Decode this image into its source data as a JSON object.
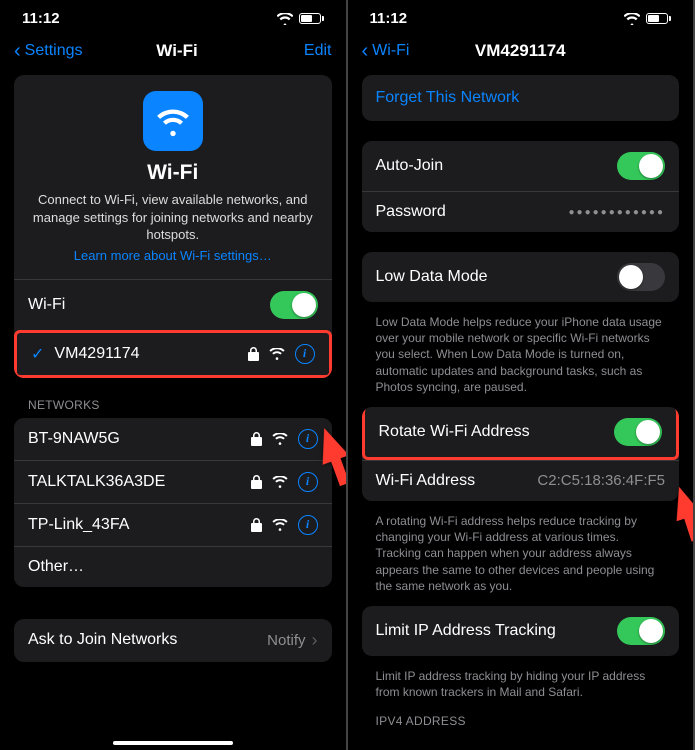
{
  "status": {
    "time": "11:12"
  },
  "left": {
    "back": "Settings",
    "title": "Wi-Fi",
    "edit": "Edit",
    "feature": {
      "title": "Wi-Fi",
      "desc": "Connect to Wi-Fi, view available networks, and manage settings for joining networks and nearby hotspots.",
      "link": "Learn more about Wi-Fi settings…"
    },
    "wifiRow": {
      "label": "Wi-Fi"
    },
    "current": {
      "name": "VM4291174"
    },
    "networksHeader": "Networks",
    "networks": [
      {
        "name": "BT-9NAW5G"
      },
      {
        "name": "TALKTALK36A3DE"
      },
      {
        "name": "TP-Link_43FA"
      }
    ],
    "other": "Other…",
    "ask": {
      "label": "Ask to Join Networks",
      "value": "Notify"
    }
  },
  "right": {
    "back": "Wi-Fi",
    "title": "VM4291174",
    "forget": "Forget This Network",
    "autoJoin": "Auto-Join",
    "password": "Password",
    "passwordDots": "●●●●●●●●●●●●",
    "lowData": {
      "label": "Low Data Mode",
      "desc": "Low Data Mode helps reduce your iPhone data usage over your mobile network or specific Wi-Fi networks you select. When Low Data Mode is turned on, automatic updates and background tasks, such as Photos syncing, are paused."
    },
    "rotate": {
      "label": "Rotate Wi-Fi Address"
    },
    "wifiAddr": {
      "label": "Wi-Fi Address",
      "value": "C2:C5:18:36:4F:F5"
    },
    "rotateDesc": "A rotating Wi-Fi address helps reduce tracking by changing your Wi-Fi address at various times. Tracking can happen when your address always appears the same to other devices and people using the same network as you.",
    "limit": {
      "label": "Limit IP Address Tracking",
      "desc": "Limit IP address tracking by hiding your IP address from known trackers in Mail and Safari."
    },
    "ipv4": "IPV4 ADDRESS"
  }
}
